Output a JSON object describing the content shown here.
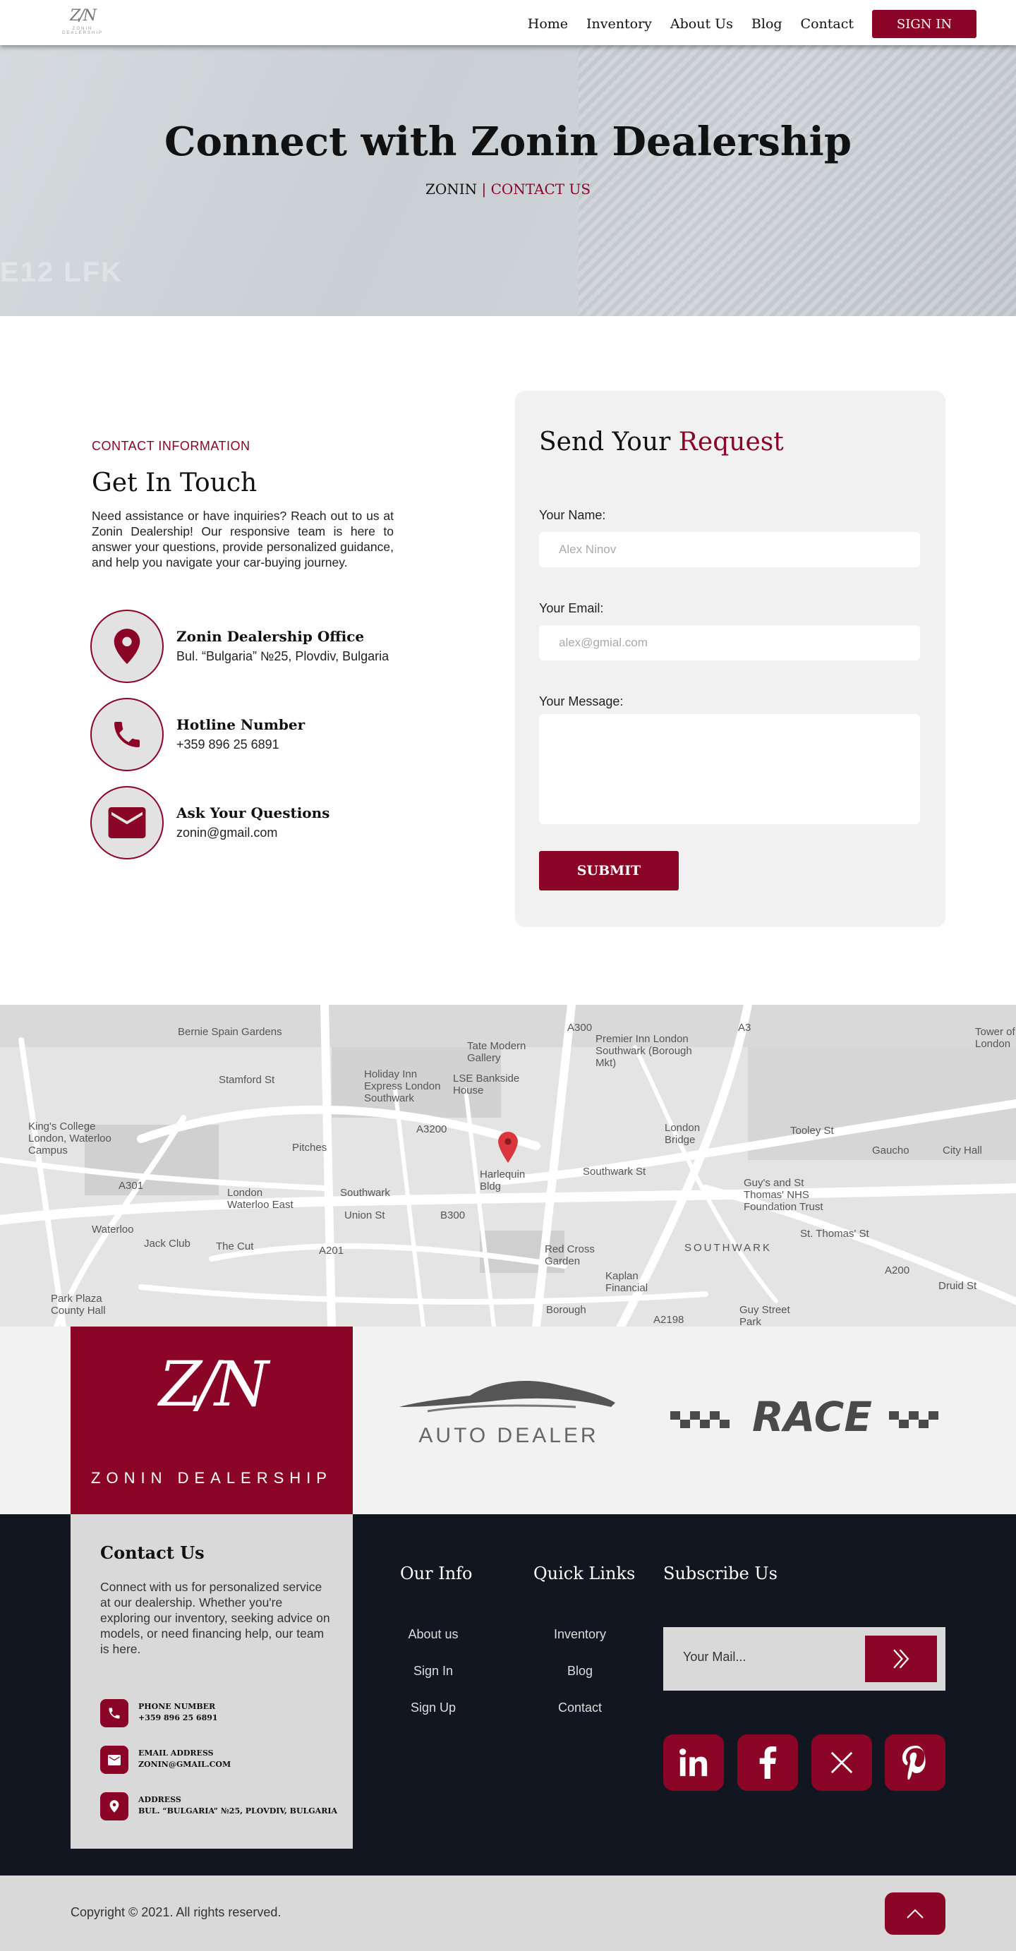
{
  "brand": {
    "logo_mark": "Z/N",
    "logo_word": "ZONIN DEALERSHIP"
  },
  "nav": {
    "items": [
      "Home",
      "Inventory",
      "About Us",
      "Blog",
      "Contact"
    ],
    "signin": "SIGN IN"
  },
  "hero": {
    "title": "Connect with Zonin Dealership",
    "crumb_home": "ZONIN",
    "crumb_sep": " | ",
    "crumb_current": "CONTACT US",
    "plate_text": "E12 LFK"
  },
  "contact_info": {
    "eyebrow": "CONTACT INFORMATION",
    "title": "Get In Touch",
    "description": "Need assistance or have inquiries? Reach out to us at Zonin Dealership! Our responsive team is here to answer your questions, provide personalized guidance, and help you navigate your car-buying journey.",
    "items": [
      {
        "icon": "location-pin-icon",
        "title": "Zonin Dealership Office",
        "value": "Bul. “Bulgaria” №25, Plovdiv, Bulgaria"
      },
      {
        "icon": "phone-icon",
        "title": "Hotline Number",
        "value": "+359 896 25 6891"
      },
      {
        "icon": "envelope-icon",
        "title": "Ask Your Questions",
        "value": "zonin@gmail.com"
      }
    ]
  },
  "form": {
    "title_plain": "Send Your ",
    "title_accent": "Request",
    "name_label": "Your Name:",
    "name_placeholder": "Alex Ninov",
    "email_label": "Your Email:",
    "email_placeholder": "alex@gmial.com",
    "message_label": "Your Message:",
    "submit": "SUBMIT"
  },
  "map": {
    "labels": [
      "Bernie Spain Gardens",
      "Tate Modern Gallery",
      "Premier Inn London Southwark (Borough Mkt)",
      "Holiday Inn Express London Southwark",
      "LSE Bankside House",
      "Stamford St",
      "King's College London, Waterloo Campus",
      "A3200",
      "Pitches",
      "London Bridge",
      "Tooley St",
      "Gaucho",
      "City Hall",
      "Harlequin Bldg",
      "Southwark St",
      "London Waterloo East",
      "Southwark",
      "Union St",
      "B300",
      "Waterloo",
      "Jack Club",
      "The Cut",
      "Guy's and St Thomas' NHS Foundation Trust",
      "SOUTHWARK",
      "St. Thomas' St",
      "Red Cross Garden",
      "Kaplan Financial",
      "Park Plaza County Hall",
      "Borough",
      "Guy Street Park",
      "A2198",
      "Tower of London",
      "Druid St",
      "A200",
      "A3",
      "A300",
      "A201",
      "A301"
    ]
  },
  "brands": {
    "auto_dealer": "AUTO DEALER",
    "race": "RACE"
  },
  "footer": {
    "contact_title": "Contact Us",
    "contact_text": "Connect with us for personalized service at our dealership. Whether you're exploring our inventory, seeking advice on models, or need financing help, our team is here.",
    "contact_rows": [
      {
        "icon": "phone-icon",
        "label": "PHONE NUMBER",
        "value": "+359 896 25 6891"
      },
      {
        "icon": "envelope-icon",
        "label": "EMAIL ADDRESS",
        "value": "ZONIN@GMAIL.COM"
      },
      {
        "icon": "location-pin-icon",
        "label": "ADDRESS",
        "value": "BUL. “BULGARIA” №25, PLOVDIV, BULGARIA"
      }
    ],
    "our_info_title": "Our Info",
    "our_info_links": [
      "About us",
      "Sign In",
      "Sign Up"
    ],
    "quick_links_title": "Quick Links",
    "quick_links": [
      "Inventory",
      "Blog",
      "Contact"
    ],
    "subscribe_title": "Subscribe Us",
    "subscribe_placeholder": "Your Mail...",
    "socials": [
      "linkedin-icon",
      "facebook-icon",
      "x-icon",
      "pinterest-icon"
    ],
    "copyright": "Copyright © 2021. All rights reserved."
  },
  "colors": {
    "accent": "#8a0526",
    "footer_bg": "#121620",
    "panel_bg": "#d9d9d9"
  }
}
